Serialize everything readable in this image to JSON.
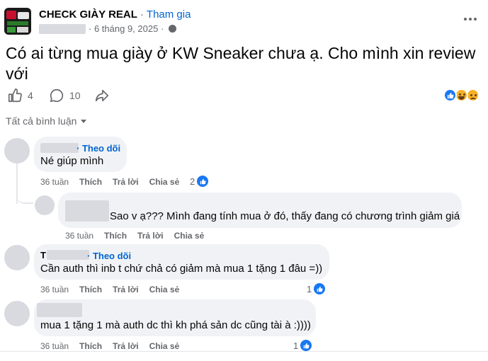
{
  "post": {
    "group_name": "CHECK GIÀY REAL",
    "separator": "·",
    "join_label": "Tham gia",
    "date": "6 tháng 9, 2025",
    "meta_separator": "·",
    "text": "Có ai từng mua giày ở KW Sneaker chưa ạ. Cho mình xin review với",
    "likes": "4",
    "comments_count": "10",
    "reactions": [
      "like",
      "haha",
      "sad"
    ]
  },
  "sort_label": "Tất cả bình luận",
  "comments": [
    {
      "follow": "· Theo dõi",
      "text": "Né giúp mình",
      "time": "36 tuần",
      "like": "Thích",
      "reply": "Trả lời",
      "share": "Chia sẻ",
      "reactions": "2"
    },
    {
      "text": "Sao v ạ??? Mình đang tính mua ở đó, thấy đang có chương trình giảm giá",
      "time": "36 tuần",
      "like": "Thích",
      "reply": "Trả lời",
      "share": "Chia sẻ"
    },
    {
      "name_initial": "T",
      "follow": "· Theo dõi",
      "text": "Cần auth thì inb t chứ chả có giảm mà mua 1 tặng 1 đâu =))",
      "time": "36 tuần",
      "like": "Thích",
      "reply": "Trả lời",
      "share": "Chia sẻ",
      "reactions": "1"
    },
    {
      "text": "mua 1 tặng 1 mà auth dc thì kh phá sản dc cũng tài à :))))",
      "time": "36 tuần",
      "like": "Thích",
      "reply": "Trả lời",
      "share": "Chia sẻ",
      "reactions": "1"
    }
  ],
  "colors": {
    "link_blue": "#0064d1",
    "like_blue": "#1877f2",
    "bubble_bg": "#f0f2f5",
    "secondary_text": "#65676b"
  },
  "icons": [
    "globe-icon",
    "more-icon",
    "like-icon",
    "comment-icon",
    "share-icon",
    "caret-down-icon"
  ]
}
